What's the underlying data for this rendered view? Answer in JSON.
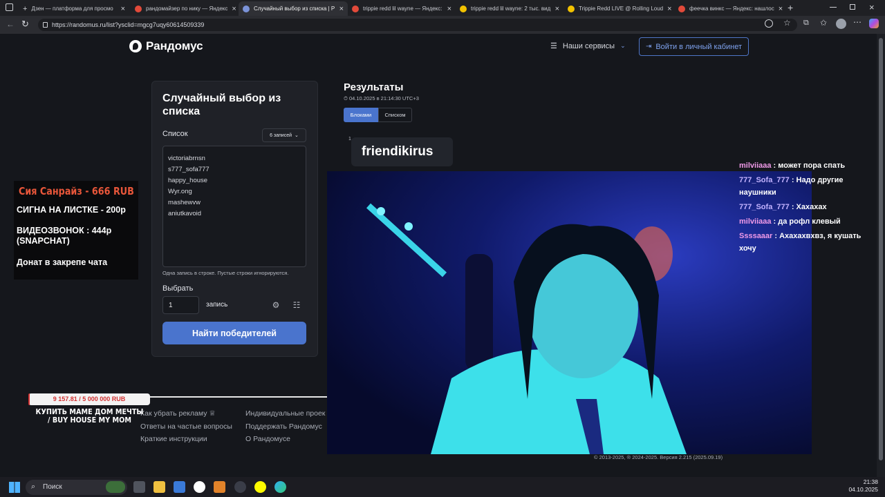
{
  "browser": {
    "tabs": [
      {
        "label": "Дзен — платформа для просмо"
      },
      {
        "label": "рандомайзер по нику — Яндекс"
      },
      {
        "label": "Случайный выбор из списка | Р"
      },
      {
        "label": "trippie redd lil wayne — Яндекс:"
      },
      {
        "label": "trippie redd lil wayne: 2 тыс. вид"
      },
      {
        "label": "Trippie Redd LIVE @ Rolling Loud"
      },
      {
        "label": "феечка винкс — Яндекс: нашлос"
      }
    ],
    "url": "https://randomus.ru/list?ysclid=mgcg7uqy60614509339"
  },
  "header": {
    "logo": "Рандомус",
    "services": "Наши сервисы",
    "login": "Войти в личный кабинет"
  },
  "form": {
    "title": "Случайный выбор из списка",
    "list_label": "Список",
    "count_select": "6 записей",
    "entries": [
      "victoriabrnsn",
      "s777_sofa777",
      "happy_house",
      "Wyr.ong",
      "mashewvw",
      "aniutkavoid"
    ],
    "hint": "Одна запись в строке. Пустые строки игнорируются.",
    "pick_label": "Выбрать",
    "pick_value": "1",
    "pick_unit": "запись",
    "find_button": "Найти победителей"
  },
  "results": {
    "title": "Результаты",
    "date": "04.10.2025 в 21:14:30 UTC+3",
    "tab_blocks": "Блоками",
    "tab_list": "Списком",
    "winner_index": "1",
    "winner": "friendikirus"
  },
  "footer": {
    "links_left": [
      "Как убрать рекламу",
      "Ответы на частые вопросы",
      "Краткие инструкции"
    ],
    "links_right": [
      "Индивидуальные проек",
      "Поддержать Рандомус",
      "О Рандомусе"
    ],
    "copyright": "© 2013-2025, ® 2024-2025. Версия 2.215 (2025.09.19)"
  },
  "stream_overlay": {
    "title": "Сия Санрайз - 666 RUB",
    "lines": [
      "СИГНА  НА ЛИСТКЕ - 200р",
      "ВИДЕОЗВОНОК  : 444р (SNAPCHAT)",
      "Донат в закрепе чата"
    ],
    "donate_progress": "9 157.81 / 5 000 000 RUB",
    "donate_goal_text": "КУПИТЬ МАМЕ ДОМ МЕЧТЫ / BUY HOUSE MY MOM"
  },
  "chat": [
    {
      "nick": "milviiaaa",
      "text": " : может пора спать"
    },
    {
      "nick": "777_Sofa_777",
      "text": " : Надо другие наушники"
    },
    {
      "nick": "777_Sofa_777",
      "text": " : Хахахах"
    },
    {
      "nick": "milviiaaa",
      "text": " : да рофл клевый"
    },
    {
      "nick": "Ssssaaar",
      "text": " : Ахахахвхвз, я кушать хочу"
    }
  ],
  "taskbar": {
    "search": "Поиск",
    "time": "21:38",
    "date": "04.10.2025"
  },
  "colors": {
    "accent": "#4a74cd",
    "page_bg": "#15171c",
    "card_bg": "#1f2127",
    "overlay_title": "#e8563a"
  }
}
